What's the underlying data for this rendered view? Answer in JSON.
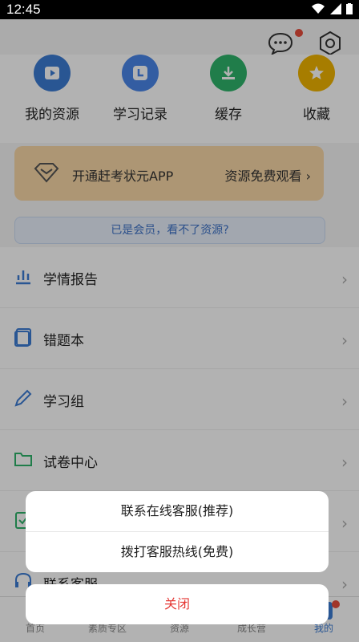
{
  "status": {
    "time": "12:45"
  },
  "quick_actions": [
    {
      "label": "我的资源",
      "icon": "play-icon",
      "color": "#3c7bd3"
    },
    {
      "label": "学习记录",
      "icon": "clock-icon",
      "color": "#4a86e8"
    },
    {
      "label": "缓存",
      "icon": "download-icon",
      "color": "#2fb36a"
    },
    {
      "label": "收藏",
      "icon": "star-icon",
      "color": "#f0b400"
    }
  ],
  "promo": {
    "left": "开通赶考状元APP",
    "right": "资源免费观看"
  },
  "vip_hint": "已是会员，看不了资源?",
  "menu": [
    {
      "label": "学情报告"
    },
    {
      "label": "错题本"
    },
    {
      "label": "学习组"
    },
    {
      "label": "试卷中心"
    },
    {
      "label": ""
    },
    {
      "label": "联系客服"
    }
  ],
  "tabs": [
    "首页",
    "素质专区",
    "资源",
    "成长营",
    "我的"
  ],
  "sheet": {
    "options": [
      "联系在线客服(推荐)",
      "拨打客服热线(免费)"
    ],
    "close": "关闭"
  },
  "colors": {
    "accent": "#3c7bd3",
    "danger": "#e53935"
  }
}
